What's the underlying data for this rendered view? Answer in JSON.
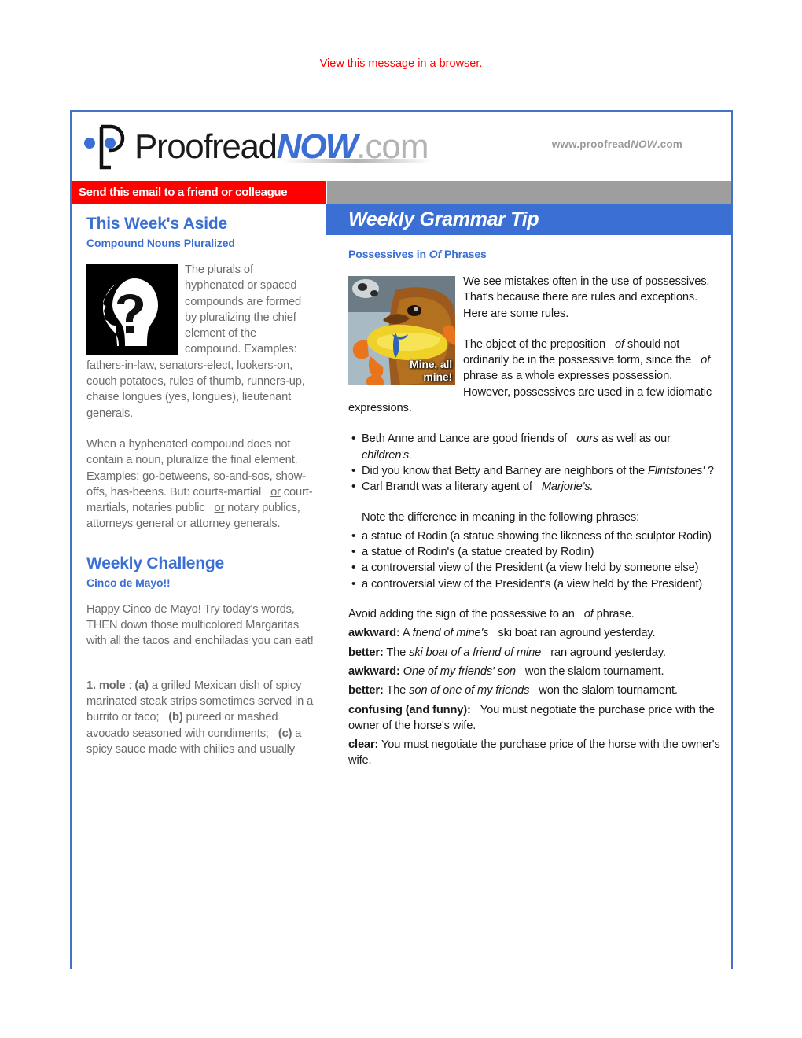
{
  "preheader": {
    "link_text": "View this message in a browser."
  },
  "masthead": {
    "logo_text_1": "Proofread",
    "logo_text_2": "NOW",
    "logo_text_3": ".com",
    "url_prefix": "www.proofread",
    "url_italic": "NOW",
    "url_suffix": ".com"
  },
  "strip": {
    "red_label": "Send this email to a friend or colleague"
  },
  "left": {
    "heading": "This Week's Aside",
    "subheading": "Compound Nouns Pluralized",
    "para1_a": "The plurals of hyphenated or spaced compounds are formed by pluralizing the chief element of the",
    "para1_b": "compound. Examples: fathers-in-law, senators-elect, lookers-on, couch potatoes, rules of thumb, runners-up, chaise longues (yes, longues), lieutenant generals.",
    "para2_a": "When a hyphenated compound does not contain a noun, pluralize the final element. Examples: go-betweens, so-and-sos, show-offs, has-beens. But: courts-martial",
    "para2_or1": "or",
    "para2_b": "court-martials, notaries public",
    "para2_or2": "or",
    "para2_c": "notary publics, attorneys general",
    "para2_or3": "or",
    "para2_d": "attorney generals.",
    "challenge_heading": "Weekly Challenge",
    "challenge_sub": "Cinco de Mayo!!",
    "challenge_para": "Happy Cinco de Mayo! Try today's words, THEN down those multicolored Margaritas with all the tacos and enchiladas you can eat!",
    "word_num": "1. mole",
    "word_colon": ":",
    "def_a_label": "(a)",
    "def_a_text": "a grilled Mexican dish of spicy marinated steak strips sometimes served in a burrito or taco;",
    "def_b_label": "(b)",
    "def_b_text": "pureed or mashed avocado seasoned with condiments;",
    "def_c_label": "(c)",
    "def_c_text": "a spicy sauce made with chilies and usually",
    "image_alt": "question-mark-head-silhouette"
  },
  "right": {
    "banner_title": "Weekly Grammar Tip",
    "subheading_a": "Possessives in",
    "subheading_ital": "Of",
    "subheading_b": "Phrases",
    "dog_caption_line1": "Mine, all",
    "dog_caption_line2": "mine!",
    "para1": "We see mistakes often in the use of possessives. That's because there are rules and exceptions. Here are some rules.",
    "para2_a": "The object of the preposition",
    "para2_of1": "of",
    "para2_b": "should not ordinarily be in the possessive form, since the",
    "para2_of2": "of",
    "para2_c": "phrase as a whole expresses possession. However, possessives are used in a few idiomatic expressions.",
    "bullets1": [
      {
        "a": "Beth Anne and Lance are good friends of",
        "i1": "ours",
        "b": "as well as our",
        "i2": "children's."
      },
      {
        "a": "Did you know that Betty and Barney are neighbors of the",
        "i1": "Flintstones'",
        "b": "?",
        "i2": ""
      },
      {
        "a": "Carl Brandt was a literary agent of",
        "i1": "Marjorie's.",
        "b": "",
        "i2": ""
      }
    ],
    "note_intro": "Note the difference in meaning in the following phrases:",
    "bullets2": [
      "a statue of Rodin (a statue showing the likeness of the sculptor Rodin)",
      "a statue of Rodin's (a statue created by Rodin)",
      "a controversial view of the President (a view held by someone else)",
      "a controversial view of the President's (a view held by the President)"
    ],
    "avoid_a": "Avoid adding the sign of the possessive to an",
    "avoid_of": "of",
    "avoid_b": "phrase.",
    "examples": [
      {
        "label": "awkward:",
        "pre": "A",
        "ital": "friend of mine's",
        "post": "ski boat ran aground yesterday."
      },
      {
        "label": "better:",
        "pre": "The",
        "ital": "ski boat of a friend of mine",
        "post": "ran aground yesterday."
      },
      {
        "label": "awkward:",
        "pre": "",
        "ital": "One of my friends' son",
        "post": "won the slalom tournament."
      },
      {
        "label": "better:",
        "pre": "The",
        "ital": "son of one of my friends",
        "post": "won the slalom tournament."
      },
      {
        "label": "confusing (and funny):",
        "pre": "You must negotiate the purchase price with the owner of the horse's wife.",
        "ital": "",
        "post": ""
      },
      {
        "label": "clear:",
        "pre": "You must negotiate the purchase price of the horse with the owner's wife.",
        "ital": "",
        "post": ""
      }
    ],
    "image_alt": "dachshund-with-toy-photo"
  },
  "colors": {
    "brand_blue": "#3B6FD4",
    "alert_red": "#FF0000",
    "gray_bar": "#9E9E9E",
    "border_blue": "#4472C4",
    "left_text": "#6B6B6B"
  }
}
